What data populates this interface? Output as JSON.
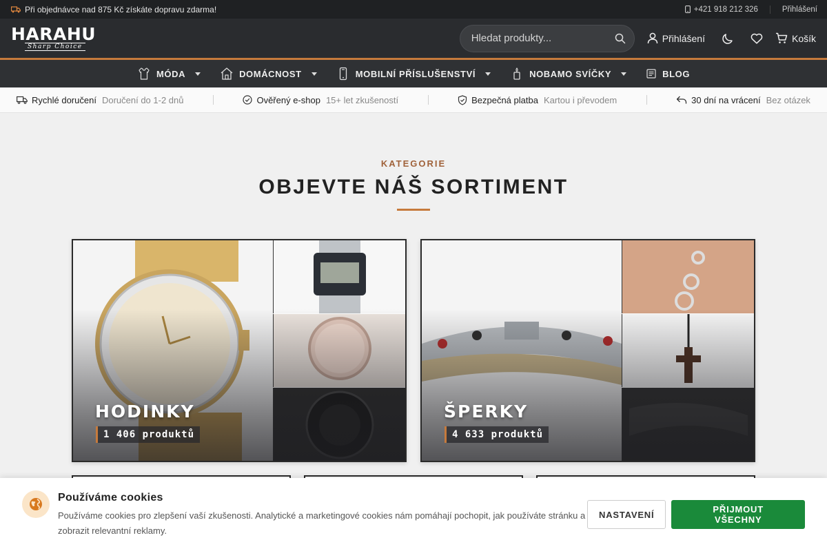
{
  "topbar": {
    "promo": "Při objednávce nad 875 Kč získáte dopravu zdarma!",
    "phone": "+421 918 212 326",
    "login": "Přihlášení"
  },
  "header": {
    "logo_name": "HARAHU",
    "logo_tagline": "Sharp Choice",
    "search_placeholder": "Hledat produkty...",
    "login_label": "Přihlášení",
    "cart_label": "Košík"
  },
  "nav": [
    {
      "label": "MÓDA",
      "icon": "fashion-icon",
      "dropdown": true
    },
    {
      "label": "DOMÁCNOST",
      "icon": "home-icon",
      "dropdown": true
    },
    {
      "label": "MOBILNÍ PŘÍSLUŠENSTVÍ",
      "icon": "phone-icon",
      "dropdown": true
    },
    {
      "label": "NOBAMO SVÍČKY",
      "icon": "candle-icon",
      "dropdown": true
    },
    {
      "label": "BLOG",
      "icon": "blog-icon",
      "dropdown": false
    }
  ],
  "benefits": [
    {
      "title": "Rychlé doručení",
      "sub": "Doručení do 1-2 dnů",
      "icon": "truck-icon"
    },
    {
      "title": "Ověřený e-shop",
      "sub": "15+ let zkušeností",
      "icon": "check-circle-icon"
    },
    {
      "title": "Bezpečná platba",
      "sub": "Kartou i převodem",
      "icon": "shield-icon"
    },
    {
      "title": "30 dní na vrácení",
      "sub": "Bez otázek",
      "icon": "return-icon"
    }
  ],
  "section": {
    "kicker": "KATEGORIE",
    "heading": "OBJEVTE NÁŠ SORTIMENT"
  },
  "categories": [
    {
      "name": "HODINKY",
      "count": "1 406 produktů"
    },
    {
      "name": "ŠPERKY",
      "count": "4 633 produktů"
    }
  ],
  "cookie": {
    "title": "Používáme cookies",
    "description": "Používáme cookies pro zlepšení vaší zkušenosti. Analytické a marketingové cookies nám pomáhají pochopit, jak používáte stránku a zobrazit relevantní reklamy.",
    "settings_label": "NASTAVENÍ",
    "accept_label": "PŘIJMOUT VŠECHNY"
  },
  "colors": {
    "accent": "#c67a3c",
    "accept_green": "#1a8a3a",
    "dark": "#2a2c2f"
  }
}
